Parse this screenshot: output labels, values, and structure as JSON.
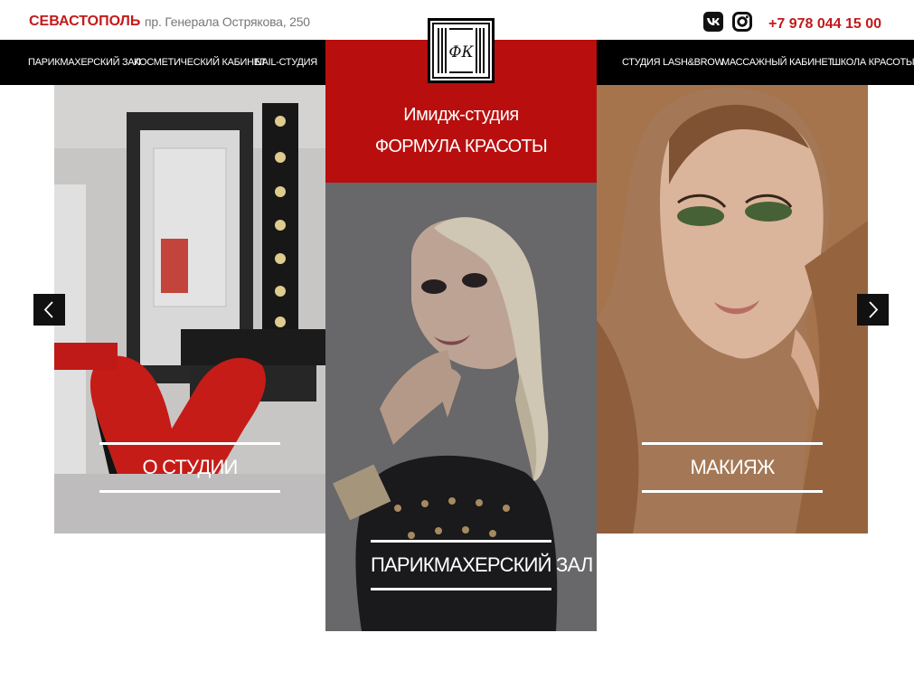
{
  "header": {
    "city": "СЕВАСТОПОЛЬ",
    "address": "пр. Генерала Острякова, 250",
    "phone": "+7 978 044 15 00",
    "social": [
      "vk-icon",
      "instagram-icon"
    ]
  },
  "nav": {
    "left": [
      "ПАРИКМАХЕРСКИЙ ЗАЛ",
      "КОСМЕТИЧЕСКИЙ КАБИНЕТ",
      "NAIL-СТУДИЯ"
    ],
    "right": [
      "СТУДИЯ LASH&BROW",
      "МАССАЖНЫЙ КАБИНЕТ",
      "ШКОЛА КРАСОТЫ"
    ]
  },
  "brand": {
    "logo_text": "ФК",
    "line1": "Имидж-студия",
    "line2": "ФОРМУЛА КРАСОТЫ"
  },
  "cards": [
    {
      "label": "О СТУДИИ"
    },
    {
      "label": "ПАРИКМАХЕРСКИЙ ЗАЛ"
    },
    {
      "label": "МАКИЯЖ"
    }
  ],
  "colors": {
    "accent": "#c41a1a",
    "brand_block": "#b80e0e",
    "nav_bg": "#000000"
  }
}
